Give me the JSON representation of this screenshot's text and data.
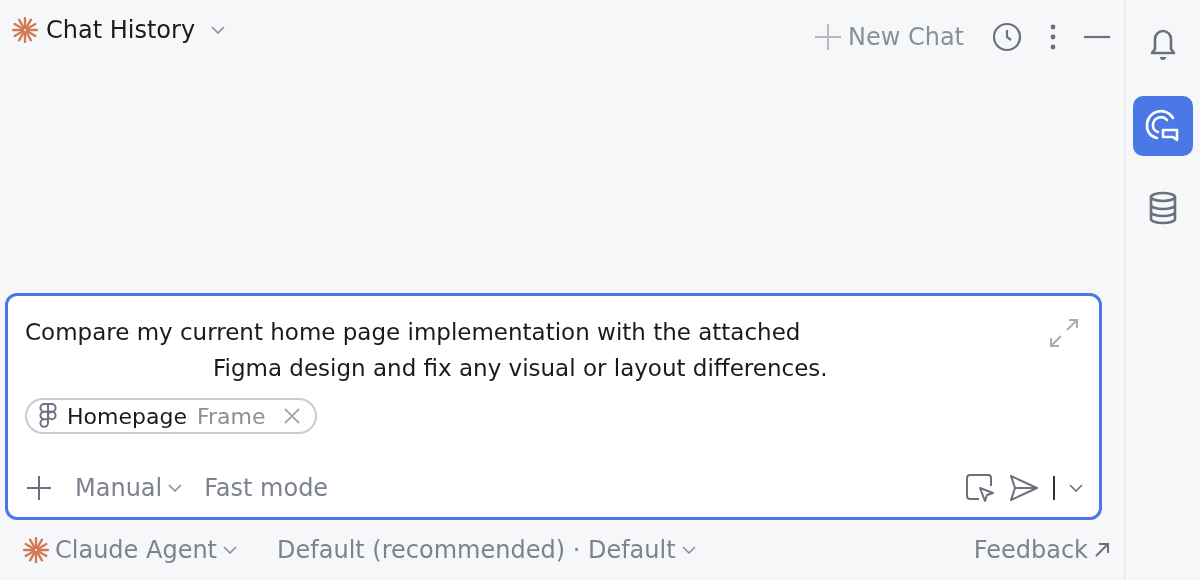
{
  "header": {
    "title": "Chat History",
    "new_chat": "New Chat"
  },
  "composer": {
    "message_lines": [
      "Compare my current home page implementation with the attached",
      "Figma design and fix any visual or layout differences."
    ],
    "attachment": {
      "name": "Homepage",
      "type": "Frame"
    },
    "mode": "Manual",
    "fast_mode": "Fast mode"
  },
  "footer": {
    "agent": "Claude Agent",
    "model": "Default (recommended) · Default",
    "feedback": "Feedback"
  },
  "sidebar": {
    "items": [
      {
        "kind": "notifications",
        "selected": false
      },
      {
        "kind": "ai_chat",
        "selected": true
      },
      {
        "kind": "database",
        "selected": false
      }
    ]
  }
}
